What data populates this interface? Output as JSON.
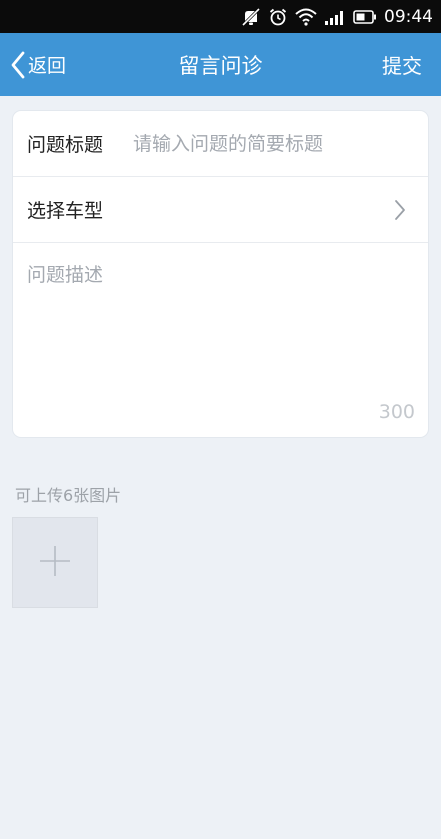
{
  "status_bar": {
    "time": "09:44",
    "icons": [
      "mute-icon",
      "alarm-icon",
      "wifi-icon",
      "signal-icon",
      "battery-icon"
    ]
  },
  "header": {
    "back_label": "返回",
    "title": "留言问诊",
    "submit_label": "提交"
  },
  "form": {
    "title_label": "问题标题",
    "title_value": "",
    "title_placeholder": "请输入问题的简要标题",
    "car_label": "选择车型",
    "description_value": "",
    "description_placeholder": "问题描述",
    "char_limit": "300"
  },
  "upload": {
    "hint": "可上传6张图片"
  },
  "colors": {
    "header_bg": "#3f95d6",
    "page_bg": "#edf1f6",
    "status_bar_bg": "#0b0b0b"
  }
}
